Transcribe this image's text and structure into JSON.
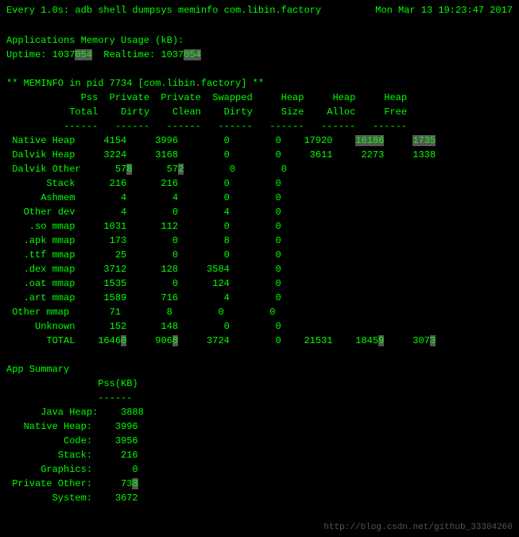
{
  "header": {
    "left": "Every 1.0s: adb shell dumpsys meminfo com.libin.factory",
    "right": "Mon Mar 13 19:23:47 2017"
  },
  "content": {
    "line1": "Applications Memory Usage (kB):",
    "line2_pre": "Uptime: 1037",
    "line2_highlight1": "054",
    "line2_mid": "  Realtime: 1037",
    "line2_highlight2": "054",
    "meminfo_block": "\n** MEMINFO in pid 7734 [com.libin.factory] **\n             Pss  Private  Private  Swapped     Heap     Heap     Heap\n           Total    Dirty    Clean    Dirty     Size    Alloc     Free\n          ------   ------   ------   ------   ------   ------   ------\n Native Heap     4154     3996        0        0    17920    1618",
    "table_block": "\n** MEMINFO in pid 7734 [com.libin.factory] **",
    "app_summary_block": "App Summary\n                Pss(KB)\n                ------\n      Java Heap:    3888\n   Native Heap:    3996\n          Code:    3956\n         Stack:     216\n      Graphics:       0\n Private Other:     73\n        System:    3672"
  },
  "watermark": "http://blog.csdn.net/github_33304260"
}
